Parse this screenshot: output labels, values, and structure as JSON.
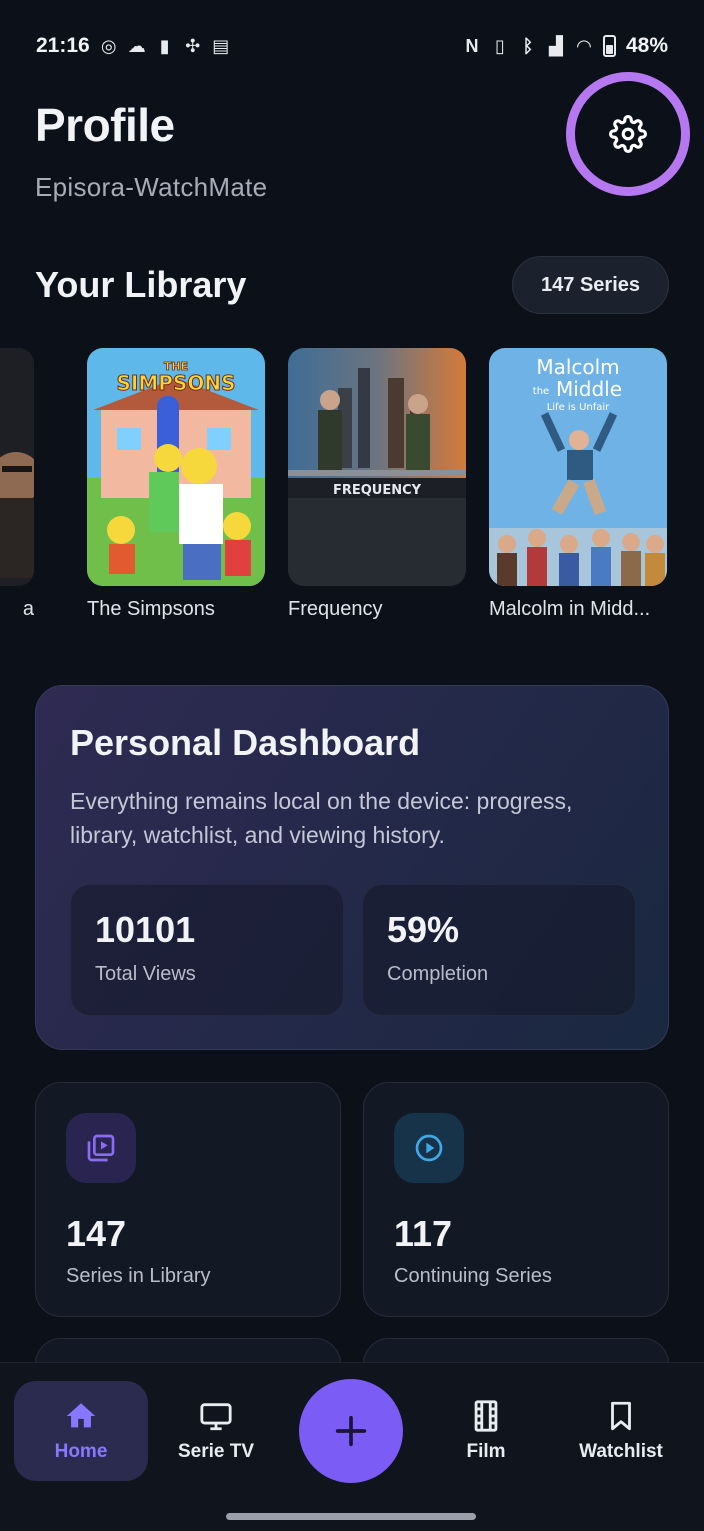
{
  "status_bar": {
    "time": "21:16",
    "battery": "48%"
  },
  "header": {
    "title": "Profile",
    "subtitle": "Episora-WatchMate"
  },
  "library": {
    "title": "Your Library",
    "count_badge": "147 Series",
    "items": [
      {
        "title": "a"
      },
      {
        "title": "The Simpsons",
        "poster_text": [
          "THE",
          "SIMPSONS"
        ]
      },
      {
        "title": "Frequency",
        "poster_text": [
          "FREQUENCY"
        ]
      },
      {
        "title": "Malcolm in Midd...",
        "poster_text": [
          "Malcolm",
          "the",
          "Middle",
          "Life is Unfair"
        ]
      }
    ]
  },
  "dashboard": {
    "title": "Personal Dashboard",
    "description": "Everything remains local on the device: progress, library, watchlist, and viewing history.",
    "stats": [
      {
        "value": "10101",
        "label": "Total Views"
      },
      {
        "value": "59%",
        "label": "Completion"
      }
    ]
  },
  "cards": [
    {
      "value": "147",
      "label": "Series in Library",
      "icon": "library-play-icon",
      "accent": "#8a6cf5"
    },
    {
      "value": "117",
      "label": "Continuing Series",
      "icon": "play-circle-icon",
      "accent": "#3fa9e6"
    }
  ],
  "bottom_nav": {
    "items": [
      {
        "label": "Home",
        "icon": "home-icon",
        "active": true
      },
      {
        "label": "Serie TV",
        "icon": "tv-icon"
      },
      {
        "label": "Film",
        "icon": "film-icon"
      },
      {
        "label": "Watchlist",
        "icon": "bookmark-icon"
      }
    ],
    "fab_icon": "plus-icon"
  },
  "colors": {
    "accent": "#7b5cf5",
    "highlight_ring": "#b678f0",
    "background": "#0c1119"
  }
}
